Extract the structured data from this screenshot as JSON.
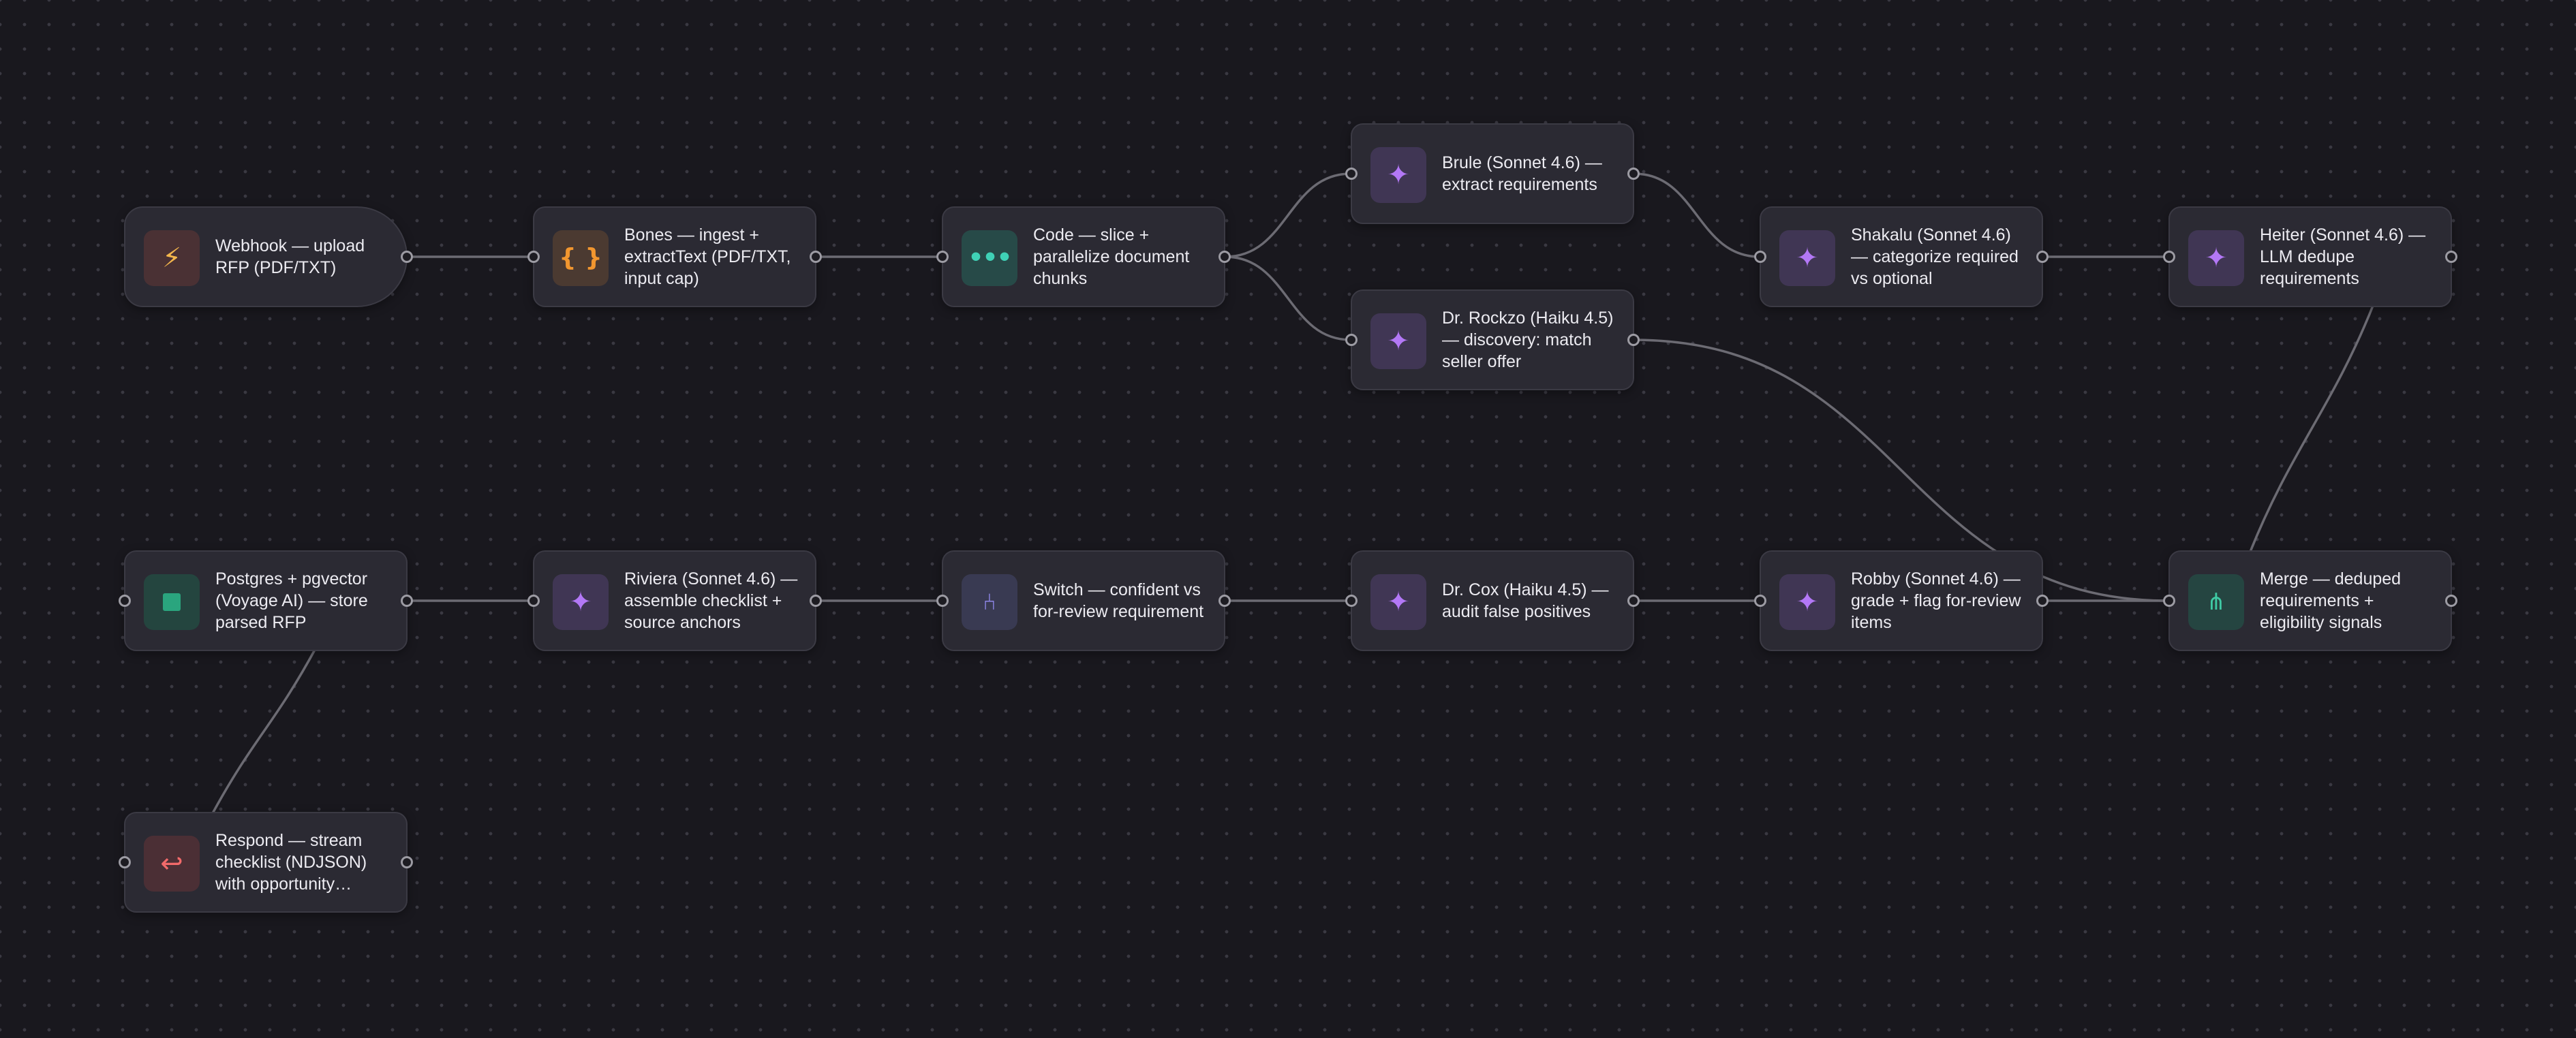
{
  "workflow": {
    "nodes": [
      {
        "id": "webhook",
        "label": "Webhook — upload RFP (PDF/TXT)",
        "icon": "bolt-icon",
        "glyph": "⚡",
        "kind": "bolt",
        "accent": "#f4b64c",
        "in": false,
        "out": true
      },
      {
        "id": "bones",
        "label": "Bones — ingest + extractText (PDF/TXT, input cap)",
        "icon": "braces-icon",
        "glyph": "{ }",
        "kind": "brace",
        "accent": "#f1962f",
        "in": true,
        "out": true
      },
      {
        "id": "code",
        "label": "Code — slice + parallelize document chunks",
        "icon": "ellipsis-icon",
        "glyph": "•••",
        "kind": "dots",
        "accent": "#3fd1b6",
        "in": true,
        "out": true
      },
      {
        "id": "brule",
        "label": "Brule (Sonnet 4.6) — extract requirements",
        "icon": "sparkle-icon",
        "glyph": "✦",
        "kind": "ai",
        "accent": "#b378f6",
        "in": true,
        "out": true
      },
      {
        "id": "rockzo",
        "label": "Dr. Rockzo (Haiku 4.5) — discovery: match seller offer",
        "icon": "sparkle-icon",
        "glyph": "✦",
        "kind": "ai",
        "accent": "#b378f6",
        "in": true,
        "out": true
      },
      {
        "id": "shakalu",
        "label": "Shakalu (Sonnet 4.6) — categorize required vs optional",
        "icon": "sparkle-icon",
        "glyph": "✦",
        "kind": "ai",
        "accent": "#b378f6",
        "in": true,
        "out": true
      },
      {
        "id": "heiter",
        "label": "Heiter (Sonnet 4.6) — LLM dedupe requirements",
        "icon": "sparkle-icon",
        "glyph": "✦",
        "kind": "ai",
        "accent": "#b378f6",
        "in": true,
        "out": true
      },
      {
        "id": "postgres",
        "label": "Postgres + pgvector (Voyage AI) — store parsed RFP",
        "icon": "database-icon",
        "glyph": "",
        "kind": "db",
        "accent": "#2aa57e",
        "in": true,
        "out": true
      },
      {
        "id": "riviera",
        "label": "Riviera (Sonnet 4.6) — assemble checklist + source anchors",
        "icon": "sparkle-icon",
        "glyph": "✦",
        "kind": "ai",
        "accent": "#b378f6",
        "in": true,
        "out": true
      },
      {
        "id": "switch",
        "label": "Switch — confident vs for-review requirement",
        "icon": "switch-icon",
        "glyph": "⑃",
        "kind": "switch",
        "accent": "#8e86e8",
        "in": true,
        "out": true
      },
      {
        "id": "cox",
        "label": "Dr. Cox (Haiku 4.5) — audit false positives",
        "icon": "sparkle-icon",
        "glyph": "✦",
        "kind": "ai",
        "accent": "#b378f6",
        "in": true,
        "out": true
      },
      {
        "id": "robby",
        "label": "Robby (Sonnet 4.6) — grade + flag for-review items",
        "icon": "sparkle-icon",
        "glyph": "✦",
        "kind": "ai",
        "accent": "#b378f6",
        "in": true,
        "out": true
      },
      {
        "id": "merge",
        "label": "Merge — deduped requirements + eligibility signals",
        "icon": "merge-icon",
        "glyph": "⋔",
        "kind": "merge",
        "accent": "#3fc9a4",
        "in": true,
        "out": true
      },
      {
        "id": "respond",
        "label": "Respond — stream checklist (NDJSON) with opportunity…",
        "icon": "return-icon",
        "glyph": "↩",
        "kind": "respond",
        "accent": "#f16a6a",
        "in": true,
        "out": true
      }
    ],
    "connections": [
      [
        "webhook",
        "bones"
      ],
      [
        "bones",
        "code"
      ],
      [
        "code",
        "brule"
      ],
      [
        "code",
        "rockzo"
      ],
      [
        "brule",
        "shakalu"
      ],
      [
        "shakalu",
        "heiter"
      ],
      [
        "heiter",
        "merge"
      ],
      [
        "rockzo",
        "merge"
      ],
      [
        "robby",
        "merge"
      ],
      [
        "merge",
        "postgres"
      ],
      [
        "postgres",
        "riviera"
      ],
      [
        "riviera",
        "switch"
      ],
      [
        "switch",
        "cox"
      ],
      [
        "cox",
        "robby"
      ],
      [
        "postgres",
        "respond"
      ]
    ]
  }
}
